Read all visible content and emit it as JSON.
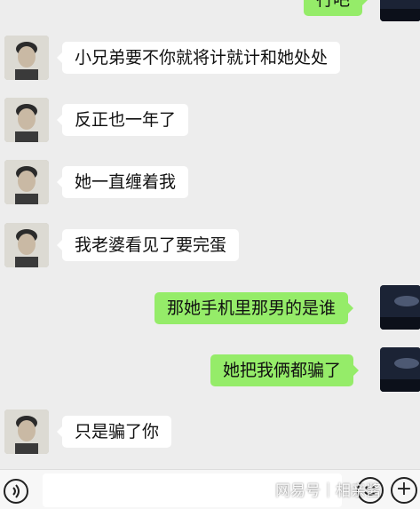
{
  "messages": [
    {
      "side": "out",
      "text": "行吧"
    },
    {
      "side": "in",
      "text": "小兄弟要不你就将计就计和她处处"
    },
    {
      "side": "in",
      "text": "反正也一年了"
    },
    {
      "side": "in",
      "text": "她一直缠着我"
    },
    {
      "side": "in",
      "text": "我老婆看见了要完蛋"
    },
    {
      "side": "out",
      "text": "那她手机里那男的是谁"
    },
    {
      "side": "out",
      "text": "她把我俩都骗了"
    },
    {
      "side": "in",
      "text": "只是骗了你"
    }
  ],
  "watermark": "网易号｜相亲酱",
  "icons": {
    "voice": "voice-icon",
    "emoji": "emoji-icon",
    "plus": "plus-icon"
  },
  "colors": {
    "background": "#ededed",
    "incoming_bubble": "#ffffff",
    "outgoing_bubble": "#95ec69"
  }
}
